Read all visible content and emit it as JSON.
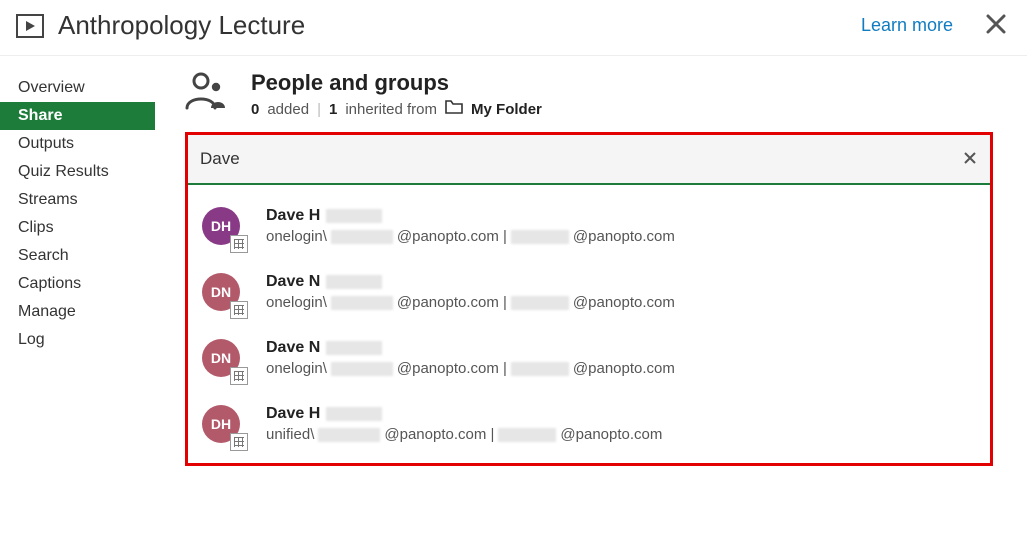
{
  "header": {
    "title": "Anthropology Lecture",
    "learn_more": "Learn more"
  },
  "sidebar": {
    "items": [
      {
        "label": "Overview",
        "active": false
      },
      {
        "label": "Share",
        "active": true
      },
      {
        "label": "Outputs",
        "active": false
      },
      {
        "label": "Quiz Results",
        "active": false
      },
      {
        "label": "Streams",
        "active": false
      },
      {
        "label": "Clips",
        "active": false
      },
      {
        "label": "Search",
        "active": false
      },
      {
        "label": "Captions",
        "active": false
      },
      {
        "label": "Manage",
        "active": false
      },
      {
        "label": "Log",
        "active": false
      }
    ]
  },
  "share": {
    "heading": "People and groups",
    "added_count": "0",
    "added_label": "added",
    "inherited_count": "1",
    "inherited_label": "inherited from",
    "folder_name": "My Folder",
    "search_value": "Dave",
    "results": [
      {
        "initials": "DH",
        "color": "purple",
        "name_prefix": "Dave H",
        "sub_prefix": "onelogin\\",
        "sub_mid": "@panopto.com | ",
        "sub_suffix": "@panopto.com"
      },
      {
        "initials": "DN",
        "color": "rose",
        "name_prefix": "Dave N",
        "sub_prefix": "onelogin\\",
        "sub_mid": "@panopto.com | ",
        "sub_suffix": "@panopto.com"
      },
      {
        "initials": "DN",
        "color": "rose",
        "name_prefix": "Dave N",
        "sub_prefix": "onelogin\\",
        "sub_mid": "@panopto.com | ",
        "sub_suffix": "@panopto.com"
      },
      {
        "initials": "DH",
        "color": "rose",
        "name_prefix": "Dave H",
        "sub_prefix": "unified\\",
        "sub_mid": "@panopto.com | ",
        "sub_suffix": "@panopto.com"
      }
    ]
  }
}
